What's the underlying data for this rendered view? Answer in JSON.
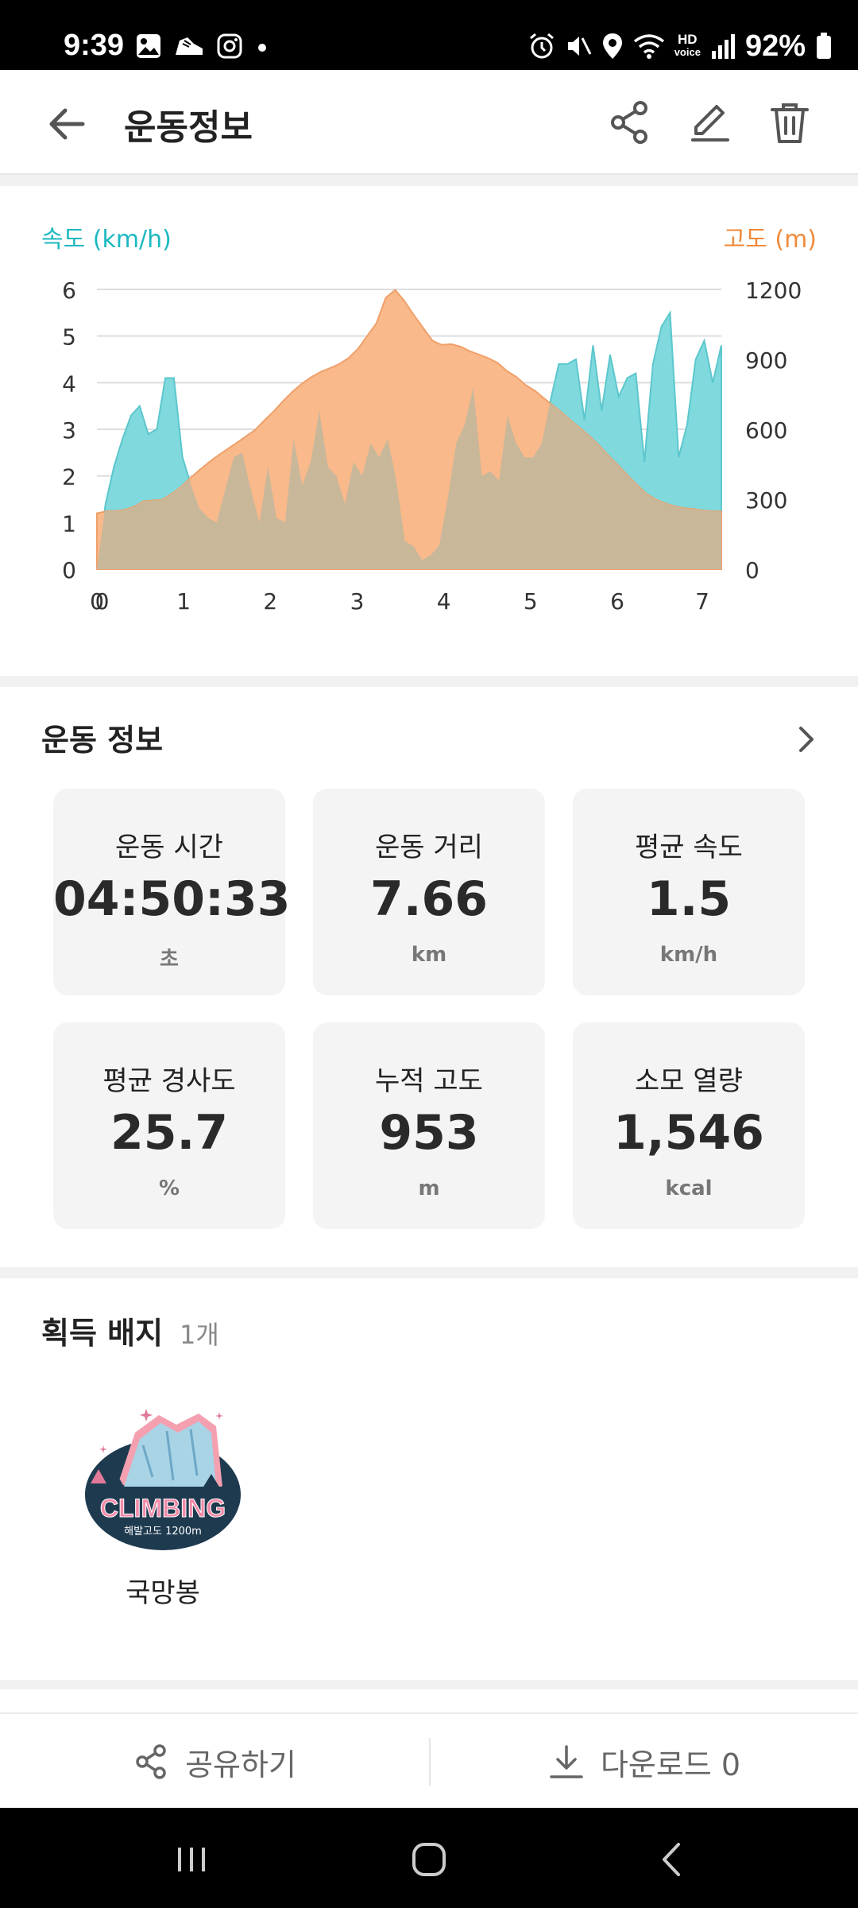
{
  "status_bar": {
    "time": "9:39",
    "battery": "92%",
    "hd_label": "HD",
    "voice_label": "voice",
    "left_icons": [
      "gallery-icon",
      "sneaker-icon",
      "instagram-icon",
      "dot-icon"
    ],
    "right_icons": [
      "alarm-icon",
      "mute-icon",
      "location-icon",
      "wifi-icon",
      "hd-voice-icon",
      "signal-icon",
      "battery-icon"
    ]
  },
  "header": {
    "title": "운동정보",
    "actions": [
      "share-icon",
      "edit-icon",
      "trash-icon"
    ]
  },
  "chart_data": {
    "type": "area",
    "left_axis_title": "속도 (km/h)",
    "right_axis_title": "고도 (m)",
    "left_ticks": [
      "6",
      "5",
      "4",
      "3",
      "2",
      "1",
      "0"
    ],
    "right_ticks": [
      "1200",
      "900",
      "600",
      "300",
      "0"
    ],
    "x_ticks": [
      "0",
      "0",
      "1",
      "2",
      "3",
      "4",
      "5",
      "6",
      "7"
    ],
    "y_left_range": [
      0,
      6
    ],
    "y_right_range": [
      0,
      1200
    ],
    "grid": true,
    "colors": {
      "speed": "#7fd9dd",
      "altitude": "#f9b98a",
      "overlap": "#c9b79a",
      "speed_title": "#1cb8c0",
      "altitude_title": "#f08a3a"
    },
    "series": [
      {
        "name": "속도 (km/h)",
        "axis": "left",
        "values": [
          0.0,
          1.4,
          2.2,
          2.8,
          3.3,
          3.5,
          2.9,
          3.0,
          4.1,
          4.1,
          2.4,
          1.8,
          1.3,
          1.1,
          1.0,
          1.7,
          2.4,
          2.5,
          1.7,
          1.0,
          2.2,
          1.1,
          1.0,
          2.8,
          1.8,
          2.3,
          3.4,
          2.2,
          2.0,
          1.4,
          2.3,
          2.0,
          2.7,
          2.4,
          2.8,
          1.9,
          0.6,
          0.5,
          0.2,
          0.3,
          0.5,
          1.5,
          2.7,
          3.1,
          3.9,
          2.0,
          2.1,
          1.9,
          3.3,
          2.7,
          2.4,
          2.4,
          2.7,
          3.6,
          4.4,
          4.4,
          4.5,
          3.2,
          4.8,
          3.4,
          4.6,
          3.7,
          4.1,
          4.2,
          2.3,
          4.4,
          5.2,
          5.5,
          2.4,
          3.1,
          4.5,
          4.9,
          4.0,
          4.8
        ]
      },
      {
        "name": "고도 (m)",
        "axis": "right",
        "values": [
          240,
          248,
          250,
          255,
          268,
          292,
          295,
          298,
          322,
          352,
          390,
          425,
          458,
          488,
          515,
          542,
          570,
          598,
          640,
          678,
          722,
          762,
          796,
          824,
          846,
          862,
          880,
          905,
          945,
          1000,
          1055,
          1165,
          1198,
          1150,
          1090,
          1035,
          980,
          962,
          965,
          955,
          935,
          920,
          905,
          885,
          850,
          825,
          790,
          765,
          732,
          700,
          668,
          632,
          600,
          565,
          525,
          482,
          442,
          400,
          360,
          322,
          298,
          282,
          270,
          262,
          258,
          252,
          248,
          248
        ]
      }
    ],
    "x_range": [
      0,
      7.2
    ]
  },
  "workout": {
    "title": "운동 정보",
    "stats": [
      {
        "label": "운동 시간",
        "value": "04:50:33",
        "unit": "초"
      },
      {
        "label": "운동 거리",
        "value": "7.66",
        "unit": "km"
      },
      {
        "label": "평균 속도",
        "value": "1.5",
        "unit": "km/h"
      },
      {
        "label": "평균 경사도",
        "value": "25.7",
        "unit": "%"
      },
      {
        "label": "누적 고도",
        "value": "953",
        "unit": "m"
      },
      {
        "label": "소모 열량",
        "value": "1,546",
        "unit": "kcal"
      }
    ]
  },
  "badges": {
    "title": "획득 배지",
    "count": "1개",
    "items": [
      {
        "name": "국망봉",
        "badge_text": "CLIMBING",
        "badge_subtext": "해발고도 1200m"
      }
    ]
  },
  "actions": {
    "share_label": "공유하기",
    "download_label": "다운로드 0"
  },
  "nav": {
    "buttons": [
      "recent-apps-icon",
      "home-icon",
      "back-nav-icon"
    ]
  }
}
